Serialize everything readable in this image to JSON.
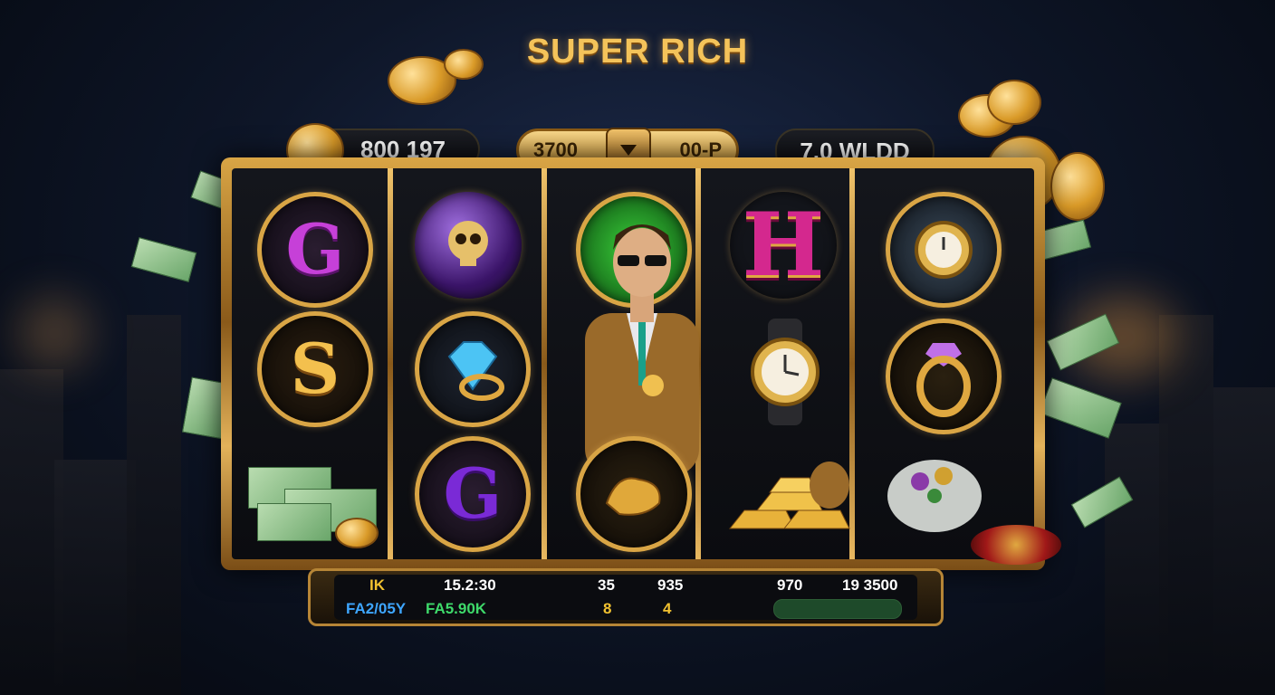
{
  "game": {
    "title": "SUPER RICH"
  },
  "header": {
    "balance": "800 197",
    "bet_left": "3700",
    "bet_right": "00-P",
    "win": "7.0 WLDD"
  },
  "reels": [
    [
      "purple-g-letter",
      "gold-s-letter",
      "cash-stacks"
    ],
    [
      "skull-gold-orb",
      "diamond-ring",
      "purple-g-letter"
    ],
    [
      "rich-man-wild",
      "rich-man-wild",
      "gold-nugget"
    ],
    [
      "magenta-h-letter",
      "gold-watch",
      "gold-bars"
    ],
    [
      "gold-watch",
      "amethyst-ring",
      "jewel-bag"
    ]
  ],
  "symbols": {
    "purple_letter": "G",
    "gold_letter": "S",
    "magenta_letter": "H"
  },
  "info_bar": {
    "row1": [
      "IK",
      "15.2:30",
      "35",
      "935",
      "970",
      "19 3500"
    ],
    "row2": [
      "FA2/05Y",
      "FA5.90K",
      "8",
      "4"
    ]
  },
  "colors": {
    "gold": "#d9a545",
    "title": "#f4c35a",
    "blue_text": "#3ea6ff",
    "green_text": "#3ed96a",
    "yellow_text": "#f2c230"
  }
}
